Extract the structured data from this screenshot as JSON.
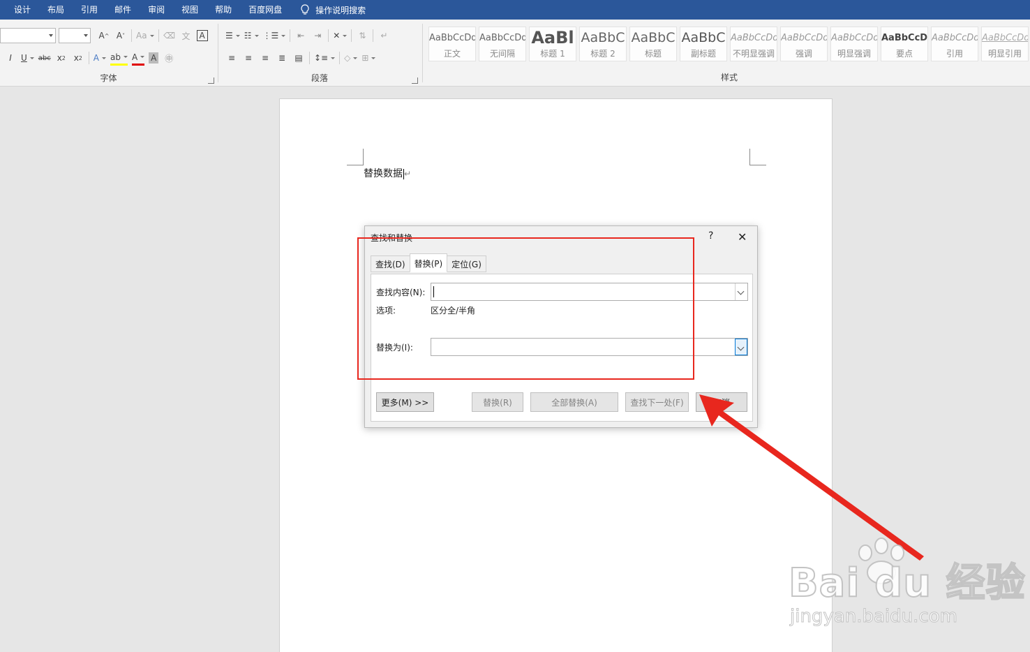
{
  "menu": {
    "items": [
      "设计",
      "布局",
      "引用",
      "邮件",
      "审阅",
      "视图",
      "帮助",
      "百度网盘"
    ],
    "tell_me": "操作说明搜索"
  },
  "ribbon": {
    "font_group_label": "字体",
    "paragraph_group_label": "段落",
    "styles_group_label": "样式",
    "styles": [
      {
        "preview": "AaBbCcDd",
        "name": "正文"
      },
      {
        "preview": "AaBbCcDd",
        "name": "无间隔"
      },
      {
        "preview": "AaBl",
        "name": "标题 1"
      },
      {
        "preview": "AaBbC",
        "name": "标题 2"
      },
      {
        "preview": "AaBbC",
        "name": "标题"
      },
      {
        "preview": "AaBbC",
        "name": "副标题"
      },
      {
        "preview": "AaBbCcDd",
        "name": "不明显强调"
      },
      {
        "preview": "AaBbCcDd",
        "name": "强调"
      },
      {
        "preview": "AaBbCcDd",
        "name": "明显强调"
      },
      {
        "preview": "AaBbCcDd",
        "name": "要点"
      },
      {
        "preview": "AaBbCcDd",
        "name": "引用"
      },
      {
        "preview": "AaBbCcDd",
        "name": "明显引用"
      }
    ]
  },
  "document": {
    "text": "替换数据",
    "para_mark": "↵"
  },
  "dialog": {
    "title": "查找和替换",
    "help": "?",
    "close": "✕",
    "tabs": [
      "查找(D)",
      "替换(P)",
      "定位(G)"
    ],
    "find_label": "查找内容(N):",
    "find_value": "",
    "options_label": "选项:",
    "options_value": "区分全/半角",
    "replace_label": "替换为(I):",
    "replace_value": "",
    "buttons": {
      "more": "更多(M) >>",
      "replace": "替换(R)",
      "replace_all": "全部替换(A)",
      "find_next": "查找下一处(F)",
      "cancel": "取消"
    }
  },
  "watermark": {
    "brand": "Bai du 经验",
    "url": "jingyan.baidu.com"
  },
  "colors": {
    "menubar": "#2b579a",
    "annotation": "#e8271e"
  }
}
